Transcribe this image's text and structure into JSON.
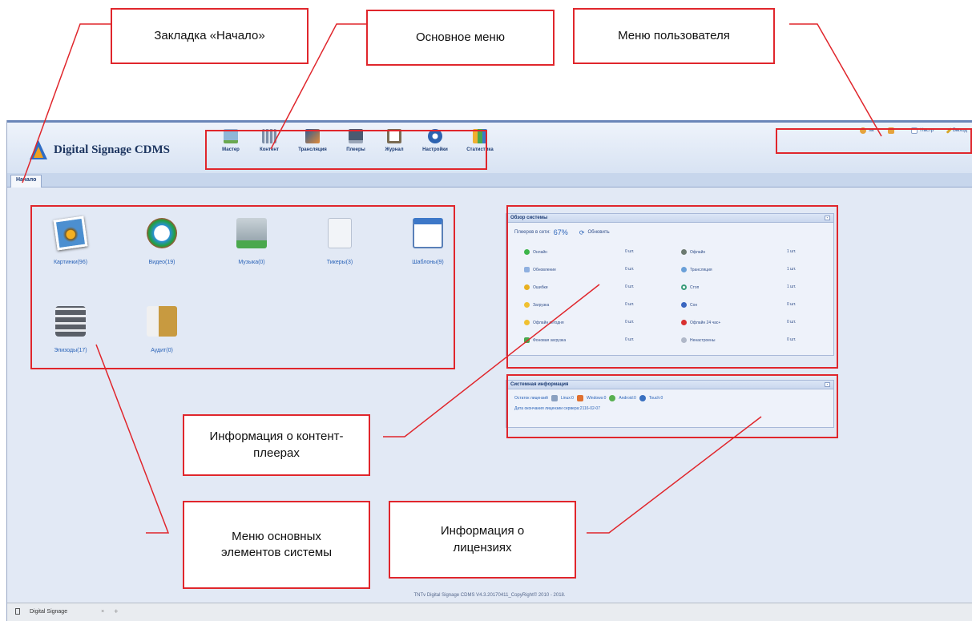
{
  "app": {
    "title": "Digital Signage CDMS",
    "home_tab": "Начало",
    "main_menu": [
      {
        "label": "Мастер",
        "icon": "wizard-icon",
        "color": "#6aa84f"
      },
      {
        "label": "Контент",
        "icon": "content-icon",
        "color": "#7d8fa8"
      },
      {
        "label": "Трансляция",
        "icon": "broadcast-icon",
        "color": "#3b6ea8"
      },
      {
        "label": "Плееры",
        "icon": "player-icon",
        "color": "#4a5a70"
      },
      {
        "label": "Журнал",
        "icon": "journal-icon",
        "color": "#d2a24a"
      },
      {
        "label": "Настройки",
        "icon": "settings-icon",
        "color": "#2d63b0"
      },
      {
        "label": "Статистика",
        "icon": "statistics-icon",
        "color": "#e0a030"
      }
    ],
    "user_menu": [
      {
        "label": "sa",
        "icon": "user-icon",
        "color": "#e6a23c"
      },
      {
        "label": "",
        "icon": "mail-icon",
        "color": "#e6a23c"
      },
      {
        "label": "Настр",
        "icon": "settings-icon",
        "color": "#8ca2c8"
      },
      {
        "label": "Выход",
        "icon": "exit-icon",
        "color": "#d8a52a"
      }
    ],
    "elements": [
      {
        "label": "Картинки(96)",
        "icon": "pictures-icon"
      },
      {
        "label": "Видео(19)",
        "icon": "video-icon"
      },
      {
        "label": "Музыка(0)",
        "icon": "music-icon"
      },
      {
        "label": "Тикеры(3)",
        "icon": "rss-icon"
      },
      {
        "label": "Шаблоны(9)",
        "icon": "template-icon"
      },
      {
        "label": "Эпизоды(17)",
        "icon": "episodes-icon"
      },
      {
        "label": "Аудит(0)",
        "icon": "audit-icon"
      }
    ],
    "overview": {
      "title": "Обзор системы",
      "online_label": "Плееров в сети:",
      "online_value": "67%",
      "refresh": "Обновить",
      "left": [
        {
          "label": "Онлайн",
          "value": "0 шт.",
          "color": "#3cb54a"
        },
        {
          "label": "Обновление",
          "value": "0 шт.",
          "color": "#8fb0e0"
        },
        {
          "label": "Ошибки",
          "value": "0 шт.",
          "color": "#e8b020"
        },
        {
          "label": "Загрузка",
          "value": "0 шт.",
          "color": "#f0c030"
        },
        {
          "label": "Офлайн сегодня",
          "value": "0 шт.",
          "color": "#f0c030"
        },
        {
          "label": "Фоновая загрузка",
          "value": "0 шт.",
          "color": "#49a84d"
        }
      ],
      "right": [
        {
          "label": "Офлайн",
          "value": "1 шт.",
          "color": "#6c7a70"
        },
        {
          "label": "Трансляция",
          "value": "1 шт.",
          "color": "#6aa0d8"
        },
        {
          "label": "Стоп",
          "value": "1 шт.",
          "color": "#3a9c7a"
        },
        {
          "label": "Сон",
          "value": "0 шт.",
          "color": "#3a66c0"
        },
        {
          "label": "Офлайн 24 час+",
          "value": "0 шт.",
          "color": "#d83030"
        },
        {
          "label": "Ненастроены",
          "value": "0 шт.",
          "color": "#b0b8c8"
        }
      ]
    },
    "sysinfo": {
      "title": "Системная информация",
      "license_label": "Остаток лицензий",
      "licenses": [
        {
          "label": "Linux:0",
          "icon": "linux-icon",
          "color": "#8aa0c0"
        },
        {
          "label": "Windows:0",
          "icon": "windows-icon",
          "color": "#e07030"
        },
        {
          "label": "Android:0",
          "icon": "android-icon",
          "color": "#58b050"
        },
        {
          "label": "Touch:0",
          "icon": "touch-icon",
          "color": "#3a70c0"
        }
      ],
      "expiry": "Дата окончания лицензии сервера:2116-02-07"
    },
    "footer": "TNTv Digital Signage CDMS V4.3.20170411_CopyRight© 2010 - 2018.",
    "taskbar_tab": "Digital Signage",
    "taskbar_close": "×",
    "taskbar_add": "+"
  },
  "annotations": {
    "home_tab": "Закладка «Начало»",
    "main_menu": "Основное меню",
    "user_menu": "Меню пользователя",
    "players_info": "Информация о контент-плеерах",
    "elements_menu": "Меню основных элементов системы",
    "license_info": "Информация о лицензиях"
  }
}
